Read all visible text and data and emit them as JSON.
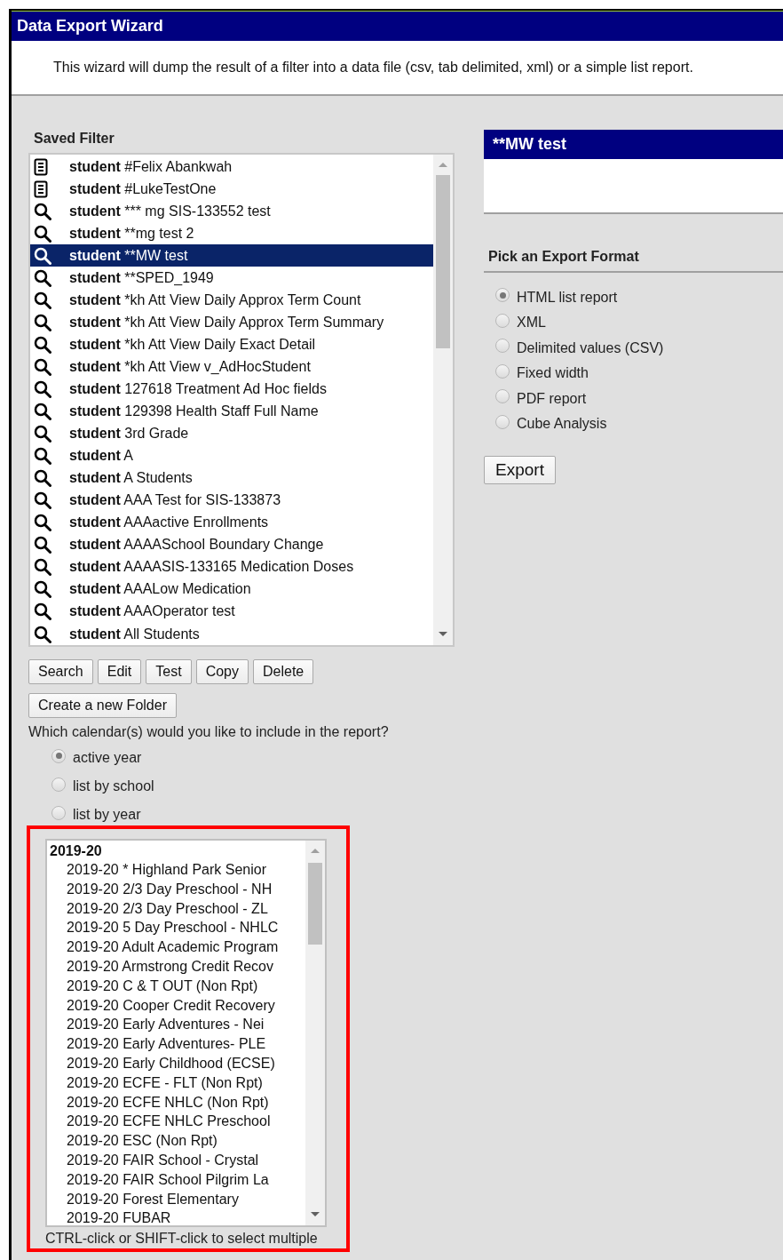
{
  "window": {
    "title": "Data Export Wizard",
    "description": "This wizard will dump the result of a filter into a data file (csv, tab delimited, xml) or a simple list report."
  },
  "saved_filter": {
    "label": "Saved Filter",
    "items": [
      {
        "kind": "report",
        "label": "**student** #Felix Abankwah",
        "selected": false
      },
      {
        "kind": "report",
        "label": "**student** #LukeTestOne",
        "selected": false
      },
      {
        "kind": "filter",
        "label": "**student** *** mg SIS-133552 test",
        "selected": false
      },
      {
        "kind": "filter",
        "label": "**student** **mg test 2",
        "selected": false
      },
      {
        "kind": "filter",
        "label": "**student** **MW test",
        "selected": true
      },
      {
        "kind": "filter",
        "label": "**student** **SPED_1949",
        "selected": false
      },
      {
        "kind": "filter",
        "label": "**student** *kh Att View Daily Approx Term Count",
        "selected": false
      },
      {
        "kind": "filter",
        "label": "**student** *kh Att View Daily Approx Term Summary",
        "selected": false
      },
      {
        "kind": "filter",
        "label": "**student** *kh Att View Daily Exact Detail",
        "selected": false
      },
      {
        "kind": "filter",
        "label": "**student** *kh Att View v_AdHocStudent",
        "selected": false
      },
      {
        "kind": "filter",
        "label": "**student** 127618 Treatment Ad Hoc fields",
        "selected": false
      },
      {
        "kind": "filter",
        "label": "**student** 129398 Health Staff Full Name",
        "selected": false
      },
      {
        "kind": "filter",
        "label": "**student** 3rd Grade",
        "selected": false
      },
      {
        "kind": "filter",
        "label": "**student** A",
        "selected": false
      },
      {
        "kind": "filter",
        "label": "**student** A Students",
        "selected": false
      },
      {
        "kind": "filter",
        "label": "**student** AAA Test for SIS-133873",
        "selected": false
      },
      {
        "kind": "filter",
        "label": "**student** AAAactive Enrollments",
        "selected": false
      },
      {
        "kind": "filter",
        "label": "**student** AAAASchool Boundary Change",
        "selected": false
      },
      {
        "kind": "filter",
        "label": "**student** AAAASIS-133165 Medication Doses",
        "selected": false
      },
      {
        "kind": "filter",
        "label": "**student** AAALow Medication",
        "selected": false
      },
      {
        "kind": "filter",
        "label": "**student** AAAOperator test",
        "selected": false
      },
      {
        "kind": "filter",
        "label": "**student** All Students",
        "selected": false
      }
    ],
    "buttons": [
      "Search",
      "Edit",
      "Test",
      "Copy",
      "Delete"
    ],
    "folder_button": "Create a new Folder"
  },
  "calendar": {
    "question": "Which calendar(s) would you like to include in the report?",
    "options": [
      {
        "label": "active year",
        "selected": true
      },
      {
        "label": "list by school",
        "selected": false
      },
      {
        "label": "list by year",
        "selected": false
      }
    ],
    "list": [
      {
        "label": "2019-20",
        "children": [
          {
            "label": "2019-20 * Highland Park Senior"
          },
          {
            "label": "2019-20 2/3 Day Preschool - NH"
          },
          {
            "label": "2019-20 2/3 Day Preschool - ZL"
          },
          {
            "label": "2019-20 5 Day Preschool - NHLC"
          },
          {
            "label": "2019-20 Adult Academic Program"
          },
          {
            "label": "2019-20 Armstrong Credit Recov"
          },
          {
            "label": "2019-20 C & T OUT (Non Rpt)"
          },
          {
            "label": "2019-20 Cooper Credit Recovery"
          },
          {
            "label": "2019-20 Early Adventures - Nei"
          },
          {
            "label": "2019-20 Early Adventures- PLE"
          },
          {
            "label": "2019-20 Early Childhood (ECSE)"
          },
          {
            "label": "2019-20 ECFE - FLT (Non Rpt)"
          },
          {
            "label": "2019-20 ECFE NHLC (Non Rpt)"
          },
          {
            "label": "2019-20 ECFE NHLC Preschool"
          },
          {
            "label": "2019-20 ESC (Non Rpt)"
          },
          {
            "label": "2019-20 FAIR School - Crystal"
          },
          {
            "label": "2019-20 FAIR School Pilgrim La"
          },
          {
            "label": "2019-20 Forest Elementary"
          },
          {
            "label": "2019-20 FUBAR"
          }
        ]
      }
    ],
    "hint": "CTRL-click or SHIFT-click to select multiple"
  },
  "selected_filter": {
    "title": "**MW test"
  },
  "export_format": {
    "heading": "Pick an Export Format",
    "options": [
      {
        "label": "HTML list report",
        "selected": true
      },
      {
        "label": "XML",
        "selected": false
      },
      {
        "label": "Delimited values (CSV)",
        "selected": false
      },
      {
        "label": "Fixed width",
        "selected": false
      },
      {
        "label": "PDF report",
        "selected": false
      },
      {
        "label": "Cube Analysis",
        "selected": false
      }
    ],
    "button": "Export"
  }
}
